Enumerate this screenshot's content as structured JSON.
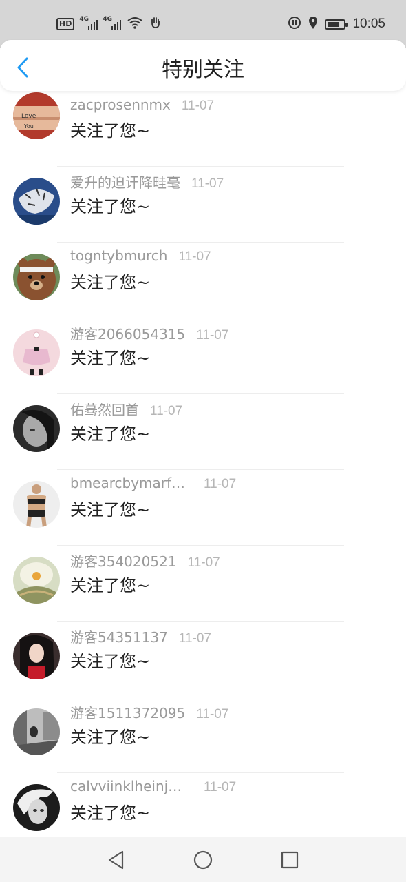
{
  "status_bar": {
    "hd": "HD",
    "sim1_label": "4G",
    "sim2_label": "4G",
    "time": "10:05",
    "battery_level": 0.75
  },
  "header": {
    "title": "特别关注",
    "back_icon": "chevron-left-icon",
    "accent_color": "#1e9af3"
  },
  "items": [
    {
      "name": "zacprosennmx",
      "date": "11-07",
      "message": "关注了您~"
    },
    {
      "name": "爱升的迫讦降畦毫",
      "date": "11-07",
      "message": "关注了您~"
    },
    {
      "name": "togntybmurch",
      "date": "11-07",
      "message": "关注了您~"
    },
    {
      "name": "游客2066054315",
      "date": "11-07",
      "message": "关注了您~"
    },
    {
      "name": "佑蓦然回首",
      "date": "11-07",
      "message": "关注了您~"
    },
    {
      "name": "bmearcbymarf…",
      "date": "11-07",
      "message": "关注了您~"
    },
    {
      "name": "游客354020521",
      "date": "11-07",
      "message": "关注了您~"
    },
    {
      "name": "游客54351137",
      "date": "11-07",
      "message": "关注了您~"
    },
    {
      "name": "游客1511372095",
      "date": "11-07",
      "message": "关注了您~"
    },
    {
      "name": "calvviinklheinj…",
      "date": "11-07",
      "message": "关注了您~"
    }
  ],
  "nav": {
    "back_icon": "triangle-back-icon",
    "home_icon": "circle-home-icon",
    "recents_icon": "square-recents-icon"
  }
}
